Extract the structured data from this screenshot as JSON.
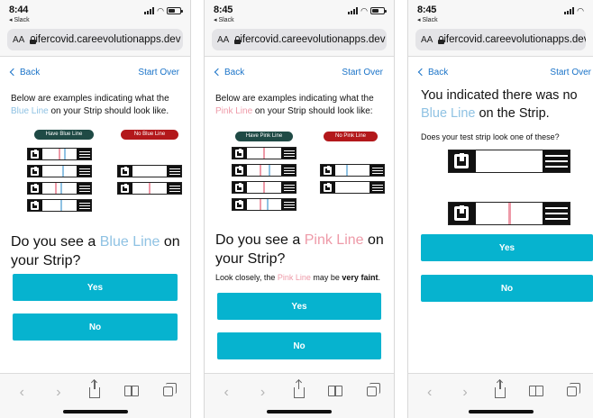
{
  "screens": [
    {
      "status": {
        "time": "8:44",
        "back_app": "◂ Slack"
      },
      "url": {
        "aa": "AA",
        "text": "ifercovid.careevolutionapps.dev"
      },
      "nav": {
        "back": "Back",
        "start_over": "Start Over"
      },
      "intro": {
        "before": "Below are examples indicating what the ",
        "color_word": "Blue Line",
        "after": " on your Strip should look like."
      },
      "pills": {
        "have": "Have Blue Line",
        "no": "No Blue Line"
      },
      "question": {
        "before": "Do you see a ",
        "color_word": "Blue Line",
        "after": " on your Strip?"
      },
      "buttons": {
        "yes": "Yes",
        "no": "No"
      }
    },
    {
      "status": {
        "time": "8:45",
        "back_app": "◂ Slack"
      },
      "url": {
        "aa": "AA",
        "text": "ifercovid.careevolutionapps.dev"
      },
      "nav": {
        "back": "Back",
        "start_over": "Start Over"
      },
      "intro": {
        "before": "Below are examples indicating what the ",
        "color_word": "Pink Line",
        "after": " on your Strip should look like:"
      },
      "pills": {
        "have": "Have Pink Line",
        "no": "No Pink Line"
      },
      "question": {
        "before": "Do you see a ",
        "color_word": "Pink Line",
        "after": " on your Strip?"
      },
      "hint": {
        "before": "Look closely, the ",
        "color_word": "Pink Line",
        "middle": " may be ",
        "bold": "very faint",
        "after": "."
      },
      "buttons": {
        "yes": "Yes",
        "no": "No"
      }
    },
    {
      "status": {
        "time": "8:45",
        "back_app": "◂ Slack"
      },
      "url": {
        "aa": "AA",
        "text": "ifercovid.careevolutionapps.dev"
      },
      "nav": {
        "back": "Back",
        "start_over": "Start Over"
      },
      "title": {
        "before": "You indicated there was no ",
        "color_word": "Blue Line",
        "after": " on the Strip."
      },
      "subtitle": "Does your test strip look one of these?",
      "buttons": {
        "yes": "Yes",
        "no": "No"
      }
    }
  ],
  "colors": {
    "accent_button": "#06b3cf",
    "blue_line": "#8fc2e3",
    "pink_line": "#ee9aa8",
    "have_pill": "#1f4a45",
    "no_pill": "#b3181b",
    "link": "#1a73c8"
  },
  "toolbar_icons": [
    "back-arrow-icon",
    "forward-arrow-icon",
    "share-icon",
    "bookmarks-icon",
    "tabs-icon"
  ]
}
